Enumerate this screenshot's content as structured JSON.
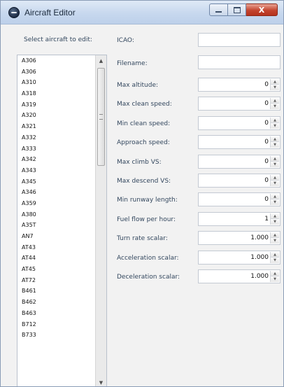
{
  "window": {
    "title": "Aircraft Editor",
    "caption_buttons": {
      "minimize": "minimize-glyph",
      "maximize": "maximize-glyph",
      "close_label": "X"
    },
    "accent_close": "#c4452f"
  },
  "sidebar": {
    "label": "Select aircraft to edit:",
    "items": [
      "A306",
      "A306",
      "A310",
      "A318",
      "A319",
      "A320",
      "A321",
      "A332",
      "A333",
      "A342",
      "A343",
      "A345",
      "A346",
      "A359",
      "A380",
      "A35T",
      "AN7",
      "AT43",
      "AT44",
      "AT45",
      "AT72",
      "B461",
      "B462",
      "B463",
      "B712",
      "B733"
    ]
  },
  "form": {
    "icao": {
      "label": "ICAO:",
      "value": ""
    },
    "filename": {
      "label": "Filename:",
      "value": ""
    },
    "numeric_fields": [
      {
        "label": "Max altitude:",
        "value": "0"
      },
      {
        "label": "Max clean speed:",
        "value": "0"
      },
      {
        "label": "Min clean speed:",
        "value": "0"
      },
      {
        "label": "Approach speed:",
        "value": "0"
      },
      {
        "label": "Max climb VS:",
        "value": "0"
      },
      {
        "label": "Max descend VS:",
        "value": "0"
      },
      {
        "label": "Min runway length:",
        "value": "0"
      },
      {
        "label": "Fuel flow per hour:",
        "value": "1"
      },
      {
        "label": "Turn rate scalar:",
        "value": "1.000"
      },
      {
        "label": "Acceleration scalar:",
        "value": "1.000"
      },
      {
        "label": "Deceleration scalar:",
        "value": "1.000"
      }
    ]
  }
}
